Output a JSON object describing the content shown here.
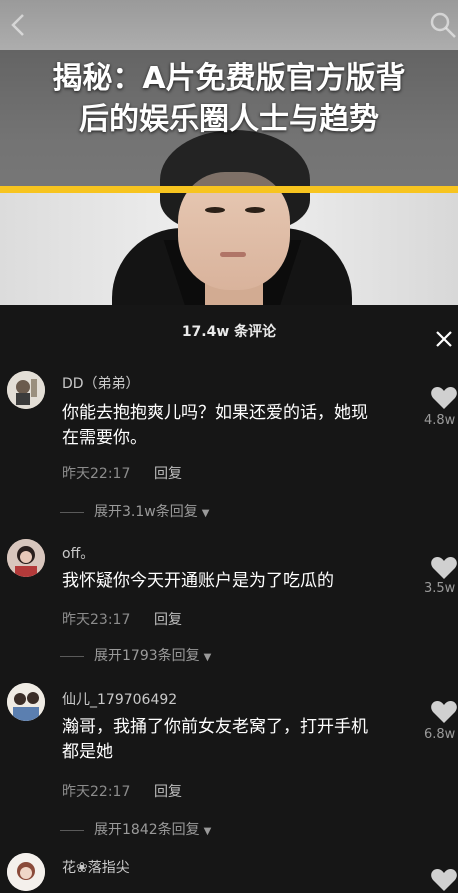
{
  "banner": {
    "title_line1": "揭秘：A片免费版官方版背",
    "title_line2": "后的娱乐圈人士与趋势"
  },
  "colors": {
    "accent": "#f7c41f",
    "panel_bg": "#161616",
    "heart": "#d0d0d0"
  },
  "icons": {
    "back": "chevron-left-icon",
    "search": "search-icon",
    "close": "close-icon",
    "like": "heart-icon",
    "expand": "triangle-down-icon"
  },
  "comments_header": {
    "count": "17.4w 条评论"
  },
  "comments": [
    {
      "username": "DD（弟弟）",
      "text_line1": "你能去抱抱爽儿吗？如果还爱的话，她现",
      "text_line2": "在需要你。",
      "time": "昨天22:17",
      "reply": "回复",
      "expand": "展开3.1w条回复",
      "likes": "4.8w"
    },
    {
      "username": "off。",
      "text_line1": "我怀疑你今天开通账户是为了吃瓜的",
      "text_line2": "",
      "time": "昨天23:17",
      "reply": "回复",
      "expand": "展开1793条回复",
      "likes": "3.5w"
    },
    {
      "username": "仙儿_179706492",
      "text_line1": "瀚哥，我捅了你前女友老窝了，打开手机",
      "text_line2": "都是她",
      "time": "昨天22:17",
      "reply": "回复",
      "expand": "展开1842条回复",
      "likes": "6.8w"
    },
    {
      "username": "花❀落指尖"
    }
  ]
}
